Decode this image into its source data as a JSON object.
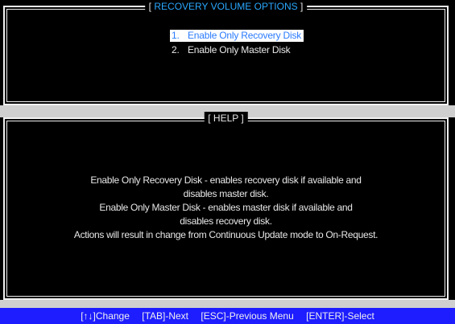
{
  "recovery_panel": {
    "title_open": "[",
    "title": "RECOVERY VOLUME OPTIONS",
    "title_close": "]",
    "items": [
      {
        "number": "1.",
        "label": "Enable Only Recovery Disk",
        "selected": true
      },
      {
        "number": "2.",
        "label": "Enable Only Master Disk",
        "selected": false
      }
    ]
  },
  "help_panel": {
    "title": "[ HELP ]",
    "lines": [
      "Enable Only Recovery Disk - enables recovery disk if available and",
      "disables master disk.",
      "Enable Only Master Disk - enables master disk if available and",
      "disables recovery disk.",
      "Actions will result in change from Continuous Update mode to On-Request."
    ]
  },
  "status_bar": {
    "change": "[↑↓]Change",
    "next": "[TAB]-Next",
    "previous": "[ESC]-Previous Menu",
    "select": "[ENTER]-Select"
  },
  "colors": {
    "background": "#000000",
    "border": "#f0f0f0",
    "title_accent": "#2aa7ff",
    "selection_bg": "#ffffff",
    "selection_text": "#2a7bff",
    "status_bar_bg": "#1d1dff"
  }
}
